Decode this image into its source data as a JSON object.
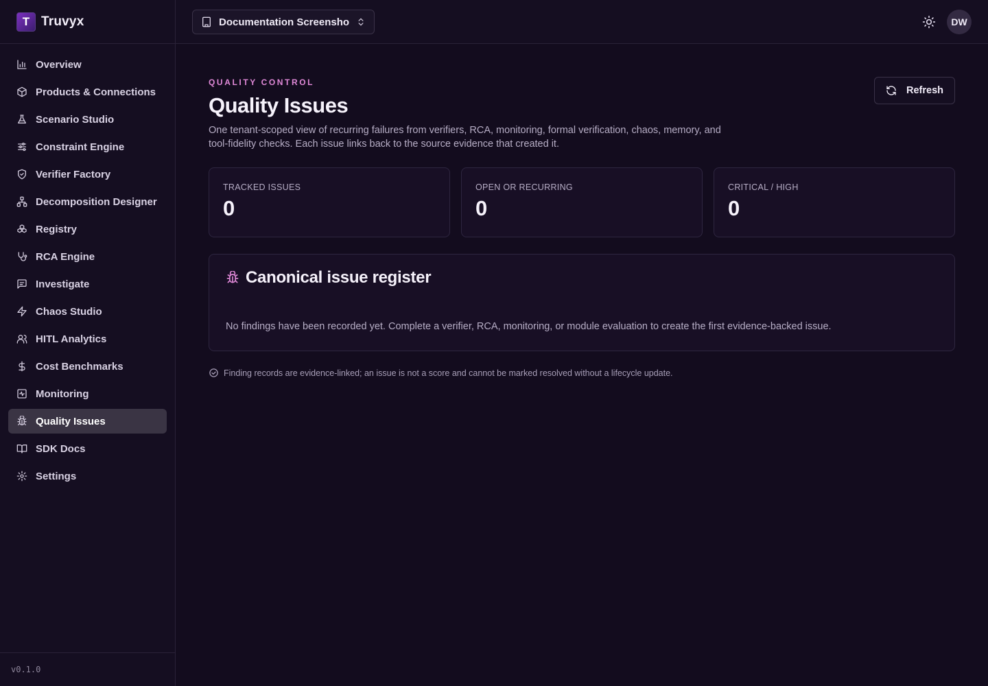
{
  "app": {
    "name": "Truvyx",
    "logo_letter": "T",
    "version": "v0.1.0"
  },
  "sidebar": {
    "items": [
      {
        "label": "Overview",
        "icon": "bar-chart-icon",
        "active": false
      },
      {
        "label": "Products & Connections",
        "icon": "box-icon",
        "active": false
      },
      {
        "label": "Scenario Studio",
        "icon": "flask-icon",
        "active": false
      },
      {
        "label": "Constraint Engine",
        "icon": "sliders-icon",
        "active": false
      },
      {
        "label": "Verifier Factory",
        "icon": "shield-check-icon",
        "active": false
      },
      {
        "label": "Decomposition Designer",
        "icon": "network-icon",
        "active": false
      },
      {
        "label": "Registry",
        "icon": "boxes-icon",
        "active": false
      },
      {
        "label": "RCA Engine",
        "icon": "stethoscope-icon",
        "active": false
      },
      {
        "label": "Investigate",
        "icon": "message-square-icon",
        "active": false
      },
      {
        "label": "Chaos Studio",
        "icon": "zap-icon",
        "active": false
      },
      {
        "label": "HITL Analytics",
        "icon": "users-icon",
        "active": false
      },
      {
        "label": "Cost Benchmarks",
        "icon": "dollar-icon",
        "active": false
      },
      {
        "label": "Monitoring",
        "icon": "activity-square-icon",
        "active": false
      },
      {
        "label": "Quality Issues",
        "icon": "bug-icon",
        "active": true
      },
      {
        "label": "SDK Docs",
        "icon": "book-open-icon",
        "active": false
      },
      {
        "label": "Settings",
        "icon": "gear-icon",
        "active": false
      }
    ]
  },
  "topbar": {
    "workspace_label": "Documentation Screensho...",
    "avatar_initials": "DW"
  },
  "page": {
    "eyebrow": "QUALITY CONTROL",
    "title": "Quality Issues",
    "description": "One tenant-scoped view of recurring failures from verifiers, RCA, monitoring, formal verification, chaos, memory, and tool-fidelity checks. Each issue links back to the source evidence that created it.",
    "refresh_label": "Refresh"
  },
  "stats": [
    {
      "label": "TRACKED ISSUES",
      "value": "0"
    },
    {
      "label": "OPEN OR RECURRING",
      "value": "0"
    },
    {
      "label": "CRITICAL / HIGH",
      "value": "0"
    }
  ],
  "register": {
    "title": "Canonical issue register",
    "empty_text": "No findings have been recorded yet. Complete a verifier, RCA, monitoring, or module evaluation to create the first evidence-backed issue."
  },
  "footnote": "Finding records are evidence-linked; an issue is not a score and cannot be marked resolved without a lifecycle update.",
  "colors": {
    "background": "#130c1e",
    "accent": "#e089d8",
    "active_item": "#3a3444"
  }
}
